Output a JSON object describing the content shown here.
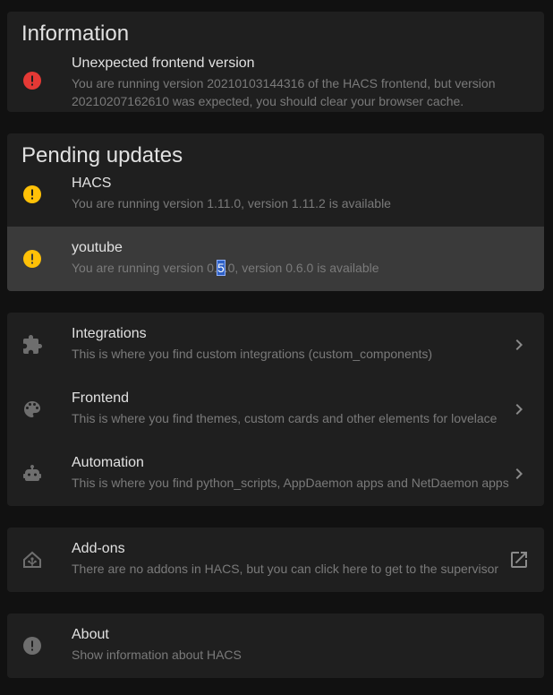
{
  "colors": {
    "error": "#e53935",
    "warning": "#ffc107",
    "muted_icon": "#6e6e6e",
    "card_bg": "#1f1f1f",
    "highlight_bg": "#3a3a3a",
    "page_bg": "#111111"
  },
  "information": {
    "title": "Information",
    "item": {
      "icon": "alert-circle-icon",
      "title": "Unexpected frontend version",
      "description": "You are running version 20210103144316 of the HACS frontend, but version 20210207162610 was expected, you should clear your browser cache."
    }
  },
  "pending": {
    "title": "Pending updates",
    "items": [
      {
        "icon": "alert-circle-icon",
        "title": "HACS",
        "description": "You are running version 1.11.0, version 1.11.2 is available"
      },
      {
        "icon": "alert-circle-icon",
        "title": "youtube",
        "description_pre": "You are running version 0.",
        "description_sel": "5",
        "description_post": ".0, version 0.6.0 is available"
      }
    ]
  },
  "categories": {
    "items": [
      {
        "icon": "puzzle-icon",
        "title": "Integrations",
        "description": "This is where you find custom integrations (custom_components)"
      },
      {
        "icon": "palette-icon",
        "title": "Frontend",
        "description": "This is where you find themes, custom cards and other elements for lovelace"
      },
      {
        "icon": "robot-icon",
        "title": "Automation",
        "description": "This is where you find python_scripts, AppDaemon apps and NetDaemon apps"
      }
    ]
  },
  "addons": {
    "icon": "home-assistant-icon",
    "title": "Add-ons",
    "description": "There are no addons in HACS, but you can click here to get to the supervisor",
    "action_icon": "open-in-new-icon"
  },
  "about": {
    "icon": "alert-circle-icon",
    "title": "About",
    "description": "Show information about HACS"
  }
}
